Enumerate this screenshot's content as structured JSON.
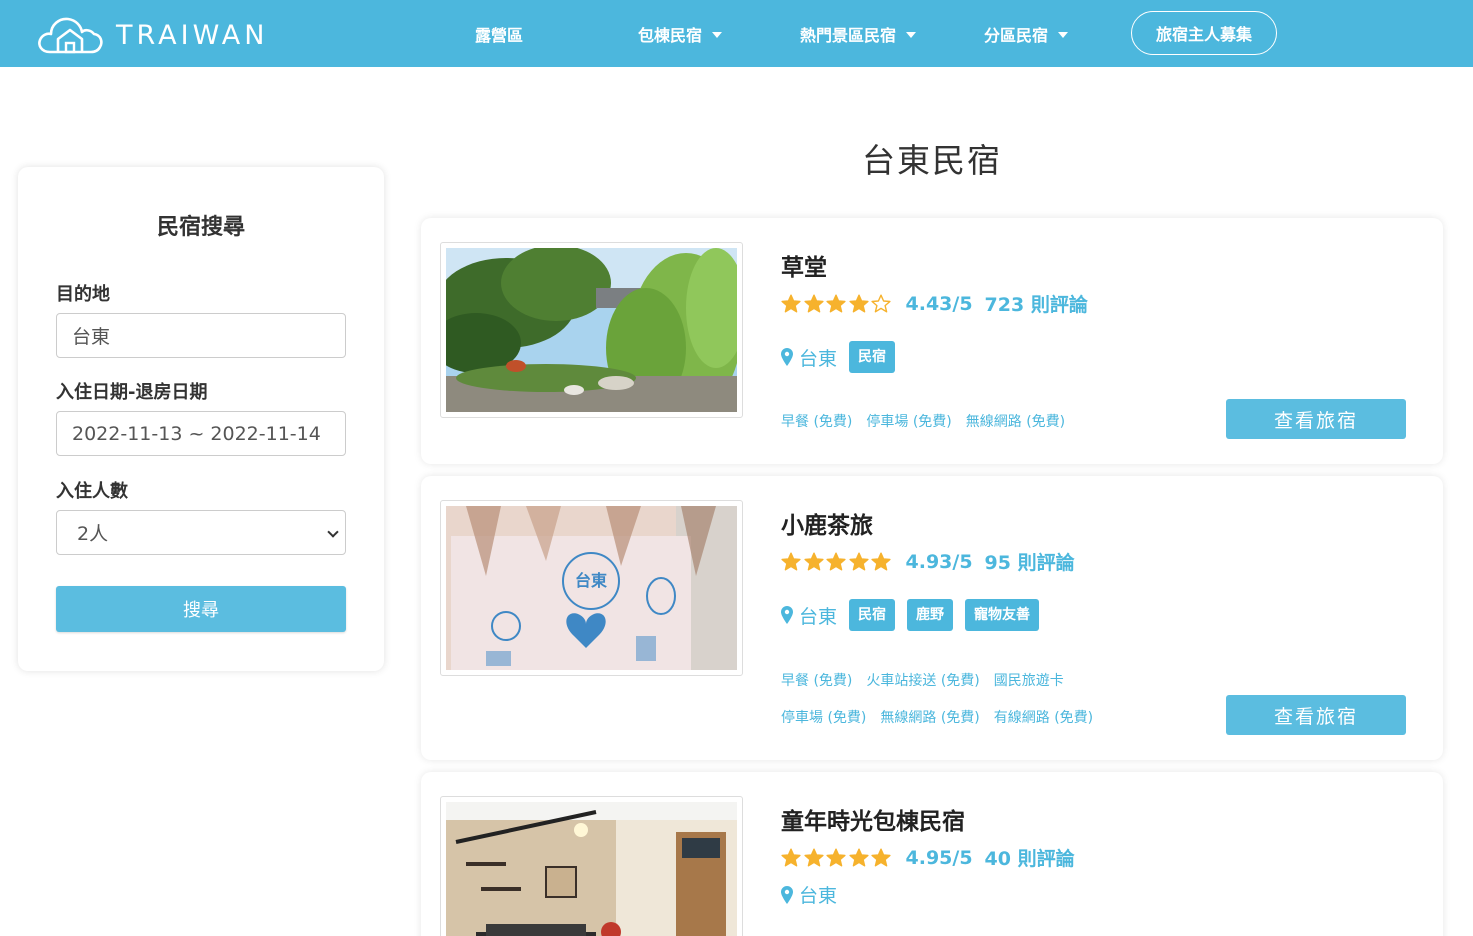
{
  "brand": {
    "name": "TRAIWAN"
  },
  "nav": {
    "items": [
      {
        "label": "露營區",
        "dropdown": false
      },
      {
        "label": "包棟民宿",
        "dropdown": true
      },
      {
        "label": "熱門景區民宿",
        "dropdown": true
      },
      {
        "label": "分區民宿",
        "dropdown": true
      }
    ],
    "host_label": "旅宿主人募集"
  },
  "search": {
    "title": "民宿搜尋",
    "destination_label": "目的地",
    "destination_value": "台東",
    "dates_label": "入住日期-退房日期",
    "dates_value": "2022-11-13 ~ 2022-11-14",
    "guests_label": "入住人數",
    "guests_value": "2人",
    "button_label": "搜尋"
  },
  "page": {
    "title": "台東民宿"
  },
  "listings": [
    {
      "name": "草堂",
      "stars": 4.43,
      "score": "4.43/5",
      "reviews": "723 則評論",
      "location": "台東",
      "tags": [
        "民宿"
      ],
      "amenities_row1": [
        "早餐 (免費)",
        "停車場 (免費)",
        "無線網路 (免費)"
      ],
      "amenities_row2": [],
      "button": "查看旅宿"
    },
    {
      "name": "小鹿茶旅",
      "stars": 4.93,
      "score": "4.93/5",
      "reviews": "95 則評論",
      "location": "台東",
      "tags": [
        "民宿",
        "鹿野",
        "寵物友善"
      ],
      "amenities_row1": [
        "早餐 (免費)",
        "火車站接送 (免費)",
        "國民旅遊卡"
      ],
      "amenities_row2": [
        "停車場 (免費)",
        "無線網路 (免費)",
        "有線網路 (免費)"
      ],
      "button": "查看旅宿"
    },
    {
      "name": "童年時光包棟民宿",
      "stars": 4.95,
      "score": "4.95/5",
      "reviews": "40 則評論",
      "location": "台東"
    }
  ],
  "colors": {
    "accent": "#4cb7dd",
    "button": "#5bbde0",
    "star": "#f6b22d"
  }
}
